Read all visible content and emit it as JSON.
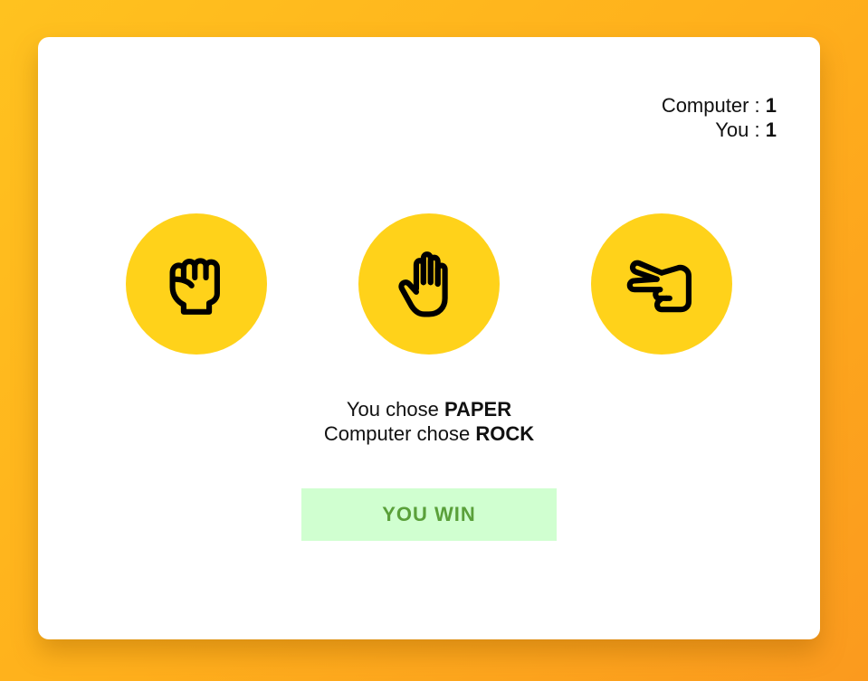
{
  "score": {
    "computer_label": "Computer : ",
    "computer_value": "1",
    "you_label": "You : ",
    "you_value": "1"
  },
  "choices": [
    {
      "name": "rock",
      "icon": "rock-fist-icon"
    },
    {
      "name": "paper",
      "icon": "paper-hand-icon"
    },
    {
      "name": "scissors",
      "icon": "scissors-hand-icon"
    }
  ],
  "result": {
    "you_prefix": "You chose ",
    "you_choice": "PAPER",
    "computer_prefix": "Computer chose ",
    "computer_choice": "ROCK"
  },
  "verdict": "YOU WIN",
  "colors": {
    "background_start": "#ffc21f",
    "background_end": "#fb9a1e",
    "card": "#ffffff",
    "choice_circle": "#ffd21a",
    "verdict_bg": "#d0ffd0",
    "verdict_text": "#5aa03a"
  }
}
